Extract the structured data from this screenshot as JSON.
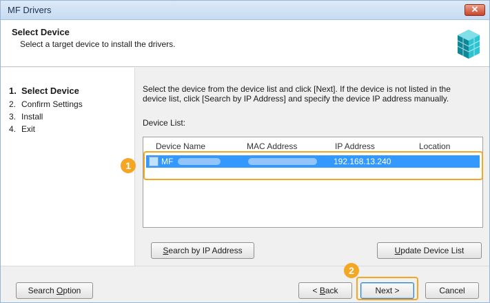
{
  "window": {
    "title": "MF Drivers",
    "close_label": "✕"
  },
  "header": {
    "title": "Select Device",
    "subtitle": "Select a target device to install the drivers."
  },
  "steps": [
    {
      "num": "1.",
      "label": "Select Device"
    },
    {
      "num": "2.",
      "label": "Confirm Settings"
    },
    {
      "num": "3.",
      "label": "Install"
    },
    {
      "num": "4.",
      "label": "Exit"
    }
  ],
  "main": {
    "description_line1": "Select the device from the device list and click [Next]. If the device is not listed in the",
    "description_line2": "device list, click [Search by IP Address] and specify the device IP address manually.",
    "device_list_label": "Device List:"
  },
  "device_list": {
    "columns": [
      "Device Name",
      "MAC Address",
      "IP Address",
      "Location"
    ],
    "rows": [
      {
        "device_name": "MF",
        "ip_address": "192.168.13.240"
      }
    ]
  },
  "buttons": {
    "search_ip_prefix": "",
    "search_ip_underline": "S",
    "search_ip_rest": "earch by IP Address",
    "update_prefix": "",
    "update_underline": "U",
    "update_rest": "pdate Device List",
    "search_option_prefix": "Search ",
    "search_option_underline": "O",
    "search_option_rest": "ption",
    "back_prefix": "< ",
    "back_underline": "B",
    "back_rest": "ack",
    "next_label": "Next >",
    "cancel_label": "Cancel"
  },
  "annotations": {
    "marker1": "1",
    "marker2": "2"
  },
  "colors": {
    "selection": "#3399ff",
    "highlight": "#f5a623"
  }
}
